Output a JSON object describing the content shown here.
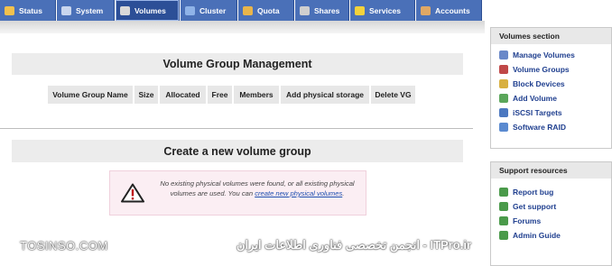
{
  "tabs": [
    {
      "label": "Status",
      "icon": "status-icon",
      "color": "#f2c14e"
    },
    {
      "label": "System",
      "icon": "system-icon",
      "color": "#c9d6ee"
    },
    {
      "label": "Volumes",
      "icon": "volumes-icon",
      "color": "#d9d9d9",
      "active": true
    },
    {
      "label": "Cluster",
      "icon": "cluster-icon",
      "color": "#8fb3e8"
    },
    {
      "label": "Quota",
      "icon": "quota-icon",
      "color": "#e9b54a"
    },
    {
      "label": "Shares",
      "icon": "shares-icon",
      "color": "#cfcfcf"
    },
    {
      "label": "Services",
      "icon": "services-icon",
      "color": "#f3d23c"
    },
    {
      "label": "Accounts",
      "icon": "accounts-icon",
      "color": "#e0a865"
    }
  ],
  "main": {
    "title": "Volume Group Management",
    "columns": [
      "Volume Group Name",
      "Size",
      "Allocated",
      "Free",
      "Members",
      "Add physical storage",
      "Delete VG"
    ],
    "create_title": "Create a new volume group",
    "alert": {
      "text_before": "No existing physical volumes were found, or all existing physical volumes are used. You can ",
      "link": "create new physical volumes",
      "text_after": "."
    }
  },
  "sidebar": {
    "volumes_title": "Volumes section",
    "volumes_items": [
      {
        "label": "Manage Volumes",
        "icon": "manage-volumes-icon",
        "color": "#6a88c8"
      },
      {
        "label": "Volume Groups",
        "icon": "volume-groups-icon",
        "color": "#c04848"
      },
      {
        "label": "Block Devices",
        "icon": "block-devices-icon",
        "color": "#d8b040"
      },
      {
        "label": "Add Volume",
        "icon": "add-volume-icon",
        "color": "#5aa65a"
      },
      {
        "label": "iSCSI Targets",
        "icon": "iscsi-targets-icon",
        "color": "#4c78c0"
      },
      {
        "label": "Software RAID",
        "icon": "software-raid-icon",
        "color": "#5a8ad0"
      }
    ],
    "support_title": "Support resources",
    "support_items": [
      {
        "label": "Report bug",
        "icon": "report-bug-icon",
        "color": "#4a9a4a"
      },
      {
        "label": "Get support",
        "icon": "get-support-icon",
        "color": "#4a9a4a"
      },
      {
        "label": "Forums",
        "icon": "forums-icon",
        "color": "#4a9a4a"
      },
      {
        "label": "Admin Guide",
        "icon": "admin-guide-icon",
        "color": "#4a9a4a"
      }
    ]
  },
  "watermark": {
    "left": "TOSINSO.COM",
    "right": "ITPro.ir - انجمن تخصصی فناوری اطلاعات ایران"
  }
}
